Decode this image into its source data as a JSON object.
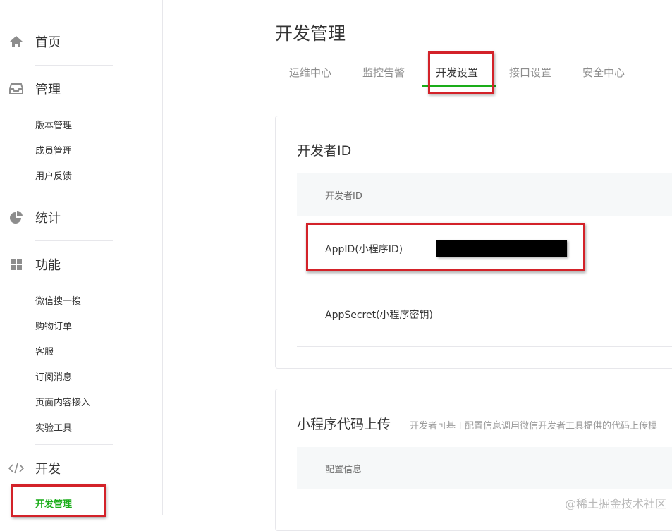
{
  "sidebar": {
    "home_label": "首页",
    "manage": {
      "label": "管理",
      "items": [
        "版本管理",
        "成员管理",
        "用户反馈"
      ]
    },
    "stats_label": "统计",
    "features": {
      "label": "功能",
      "items": [
        "微信搜一搜",
        "购物订单",
        "客服",
        "订阅消息",
        "页面内容接入",
        "实验工具"
      ]
    },
    "dev": {
      "label": "开发",
      "items": [
        "开发管理"
      ]
    }
  },
  "main": {
    "title": "开发管理",
    "tabs": [
      "运维中心",
      "监控告警",
      "开发设置",
      "接口设置",
      "安全中心"
    ],
    "active_tab": "开发设置",
    "developer_id": {
      "title": "开发者ID",
      "header": "开发者ID",
      "rows": [
        {
          "label": "AppID(小程序ID)",
          "value_redacted": true
        },
        {
          "label": "AppSecret(小程序密钥)"
        }
      ]
    },
    "code_upload": {
      "title": "小程序代码上传",
      "description": "开发者可基于配置信息调用微信开发者工具提供的代码上传模",
      "header": "配置信息"
    }
  },
  "watermark": "@稀土掘金技术社区",
  "colors": {
    "accent_green": "#1aad19",
    "highlight_red": "#d32229",
    "text": "#353535",
    "muted": "#8d8d8d"
  }
}
